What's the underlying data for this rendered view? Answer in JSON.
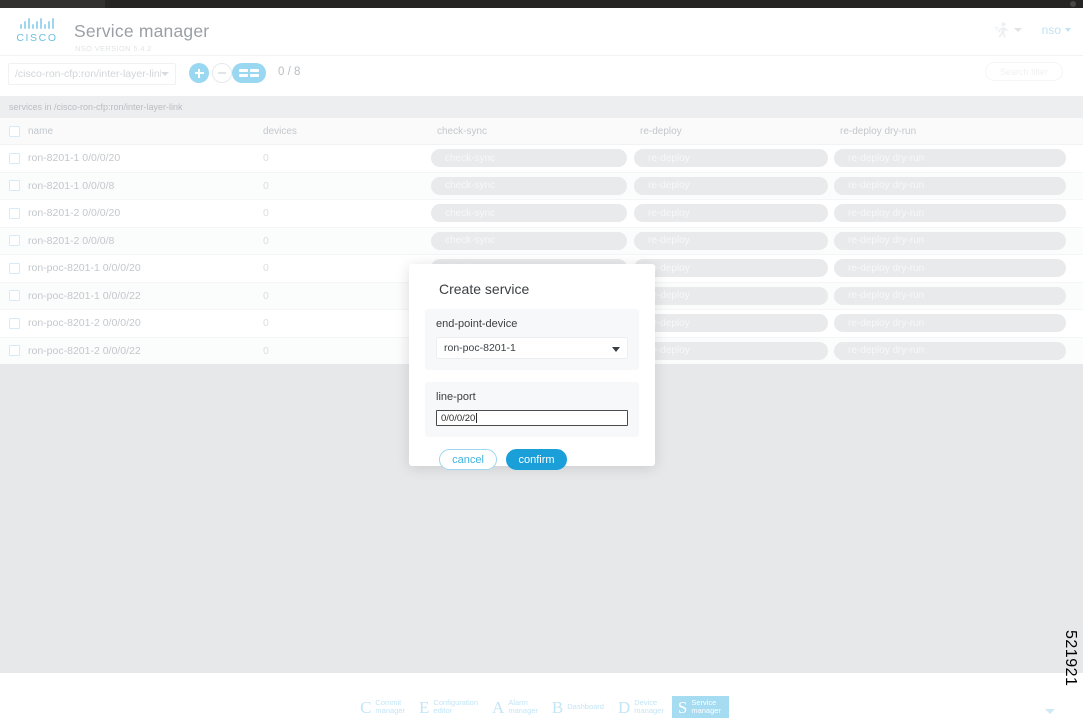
{
  "header": {
    "brand": "CISCO",
    "title": "Service manager",
    "version": "NSO VERSION 5.4.2",
    "runner_icon": "runner-icon",
    "user": "nso"
  },
  "toolbar": {
    "path_value": "/cisco-ron-cfp:ron/inter-layer-link",
    "add_label": "+",
    "delete_label": "-",
    "grid_label": "columns",
    "count": "0 / 8",
    "search_placeholder": "Search filter"
  },
  "sub_header": {
    "text": "services in /cisco-ron-cfp:ron/inter-layer-link"
  },
  "table": {
    "columns": [
      "name",
      "devices",
      "check-sync",
      "re-deploy",
      "re-deploy dry-run"
    ],
    "action_labels": {
      "check_sync": "check-sync",
      "re_deploy": "re-deploy",
      "re_deploy_dry_run": "re-deploy dry-run"
    },
    "rows": [
      {
        "name": "ron-8201-1 0/0/0/20",
        "devices": "0"
      },
      {
        "name": "ron-8201-1 0/0/0/8",
        "devices": "0"
      },
      {
        "name": "ron-8201-2 0/0/0/20",
        "devices": "0"
      },
      {
        "name": "ron-8201-2 0/0/0/8",
        "devices": "0"
      },
      {
        "name": "ron-poc-8201-1 0/0/0/20",
        "devices": "0"
      },
      {
        "name": "ron-poc-8201-1 0/0/0/22",
        "devices": "0"
      },
      {
        "name": "ron-poc-8201-2 0/0/0/20",
        "devices": "0"
      },
      {
        "name": "ron-poc-8201-2 0/0/0/22",
        "devices": "0"
      }
    ]
  },
  "modal": {
    "title": "Create service",
    "fields": [
      {
        "label": "end-point-device",
        "value": "ron-poc-8201-1",
        "type": "select"
      },
      {
        "label": "line-port",
        "value": "0/0/0/20",
        "type": "text"
      }
    ],
    "cancel_label": "cancel",
    "confirm_label": "confirm"
  },
  "bottom_nav": {
    "items": [
      {
        "letter": "C",
        "line1": "Commit",
        "line2": "manager",
        "active": false
      },
      {
        "letter": "E",
        "line1": "Configuration",
        "line2": "editor",
        "active": false
      },
      {
        "letter": "A",
        "line1": "Alarm",
        "line2": "manager",
        "active": false
      },
      {
        "letter": "B",
        "line1": "Dashboard",
        "line2": "",
        "active": false
      },
      {
        "letter": "D",
        "line1": "Device",
        "line2": "manager",
        "active": false
      },
      {
        "letter": "S",
        "line1": "Service",
        "line2": "manager",
        "active": true
      }
    ]
  },
  "figure_number": "521921",
  "colors": {
    "accent": "#1a9fd9",
    "accent_light": "#9ad7f0",
    "nav_active": "#a5dcf2",
    "body_bg": "#e6e8ea"
  }
}
